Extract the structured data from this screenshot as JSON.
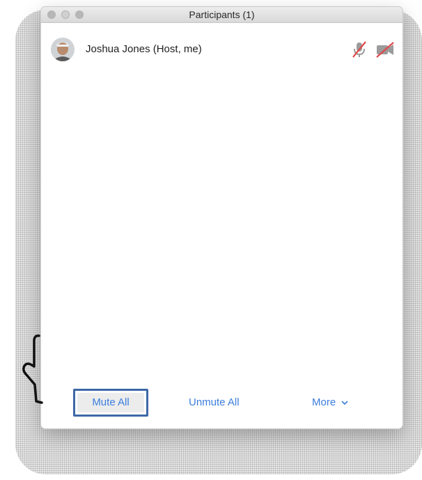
{
  "window": {
    "title": "Participants (1)"
  },
  "participants": [
    {
      "name": "Joshua Jones (Host, me)",
      "mic": "mic-muted-icon",
      "video": "video-off-icon"
    }
  ],
  "footer": {
    "mute_all": "Mute All",
    "unmute_all": "Unmute All",
    "more": "More"
  },
  "colors": {
    "accent": "#3b7ddd",
    "highlight_border": "#3d68a6",
    "muted_red": "#e0494b"
  }
}
